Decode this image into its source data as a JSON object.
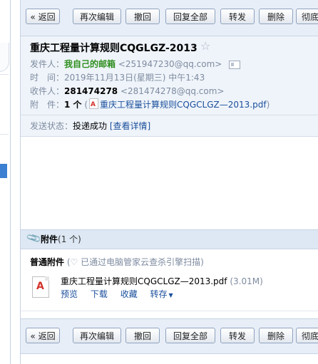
{
  "toolbar": {
    "back": "« 返回",
    "re_edit": "再次编辑",
    "recall": "撤回",
    "reply_all": "回复全部",
    "forward": "转发",
    "delete": "删除",
    "permanent_delete": "彻底"
  },
  "email": {
    "subject": "重庆工程量计算规则CQGLGZ-2013",
    "star_icon": "star-icon",
    "sender_label": "发件人：",
    "sender_name": "我自己的邮箱",
    "sender_addr": "<251947230@qq.com>",
    "time_label": "时　间：",
    "time_value": "2019年11月13日(星期三) 中午1:43",
    "recipient_label": "收件人：",
    "recipient_name": "281474278",
    "recipient_addr": "<281474278@qq.com>",
    "attachment_label": "附　件：",
    "attachment_count": "1 个",
    "attachment_open_paren": " (",
    "attachment_name": "重庆工程量计算规则CQGCLGZ—2013.pdf",
    "attachment_close_paren": ")",
    "status_label": "发送状态：",
    "status_value": "投递成功",
    "status_link": "[查看详情]"
  },
  "attachments": {
    "header_title": "附件",
    "header_count": "(1 个)",
    "normal_label": "普通附件",
    "scan_note": "已通过电脑管家云查杀引擎扫描",
    "scan_open": "(",
    "scan_close": ")",
    "file_name": "重庆工程量计算规则CQGCLGZ—2013.pdf",
    "file_size": "(3.01M)",
    "preview": "预览",
    "download": "下载",
    "favorite": "收藏",
    "save_to": "转存"
  }
}
